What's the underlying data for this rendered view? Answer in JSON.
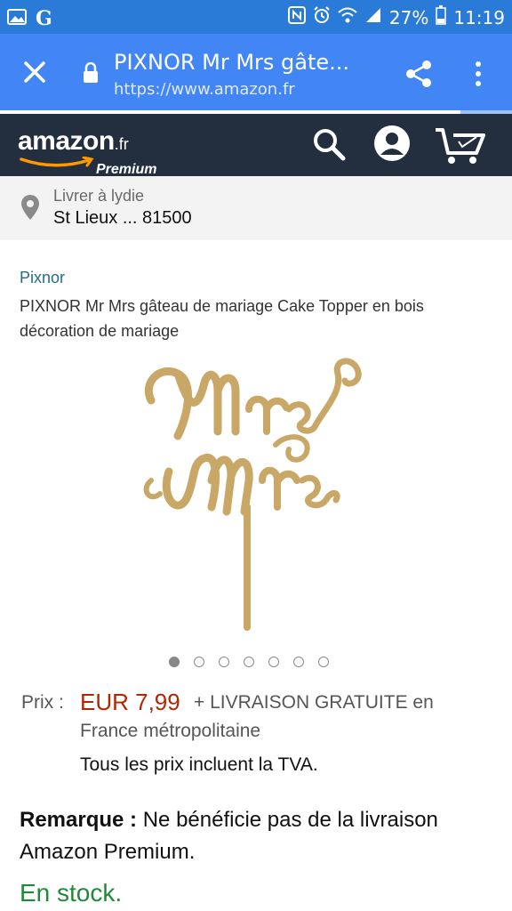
{
  "status_bar": {
    "battery": "27%",
    "time": "11:19",
    "app_letter": "G"
  },
  "address_bar": {
    "title": "PIXNOR Mr Mrs gâte...",
    "url": "https://www.amazon.fr",
    "progress_fraction": 0.9
  },
  "amazon_header": {
    "logo_word": "amazon",
    "logo_tld": ".fr",
    "logo_tier": "Premium"
  },
  "delivery": {
    "line1": "Livrer à lydie",
    "line2": "St Lieux ... 81500"
  },
  "product": {
    "brand": "Pixnor",
    "title": "PIXNOR Mr Mrs gâteau de mariage Cake Topper en bois décoration de mariage",
    "image_text_top": "Mr",
    "image_text_bottom": "Mrs",
    "image_color": "#c9a766",
    "carousel_count": 7,
    "carousel_active": 0
  },
  "pricing": {
    "label": "Prix :",
    "price": "EUR 7,99",
    "shipping_line1": "+ LIVRAISON GRATUITE en",
    "shipping_line2": "France métropolitaine",
    "tax_note": "Tous les prix incluent la TVA."
  },
  "remark": {
    "label": "Remarque :",
    "text": " Ne bénéficie pas de la livraison Amazon Premium."
  },
  "stock": "En stock."
}
